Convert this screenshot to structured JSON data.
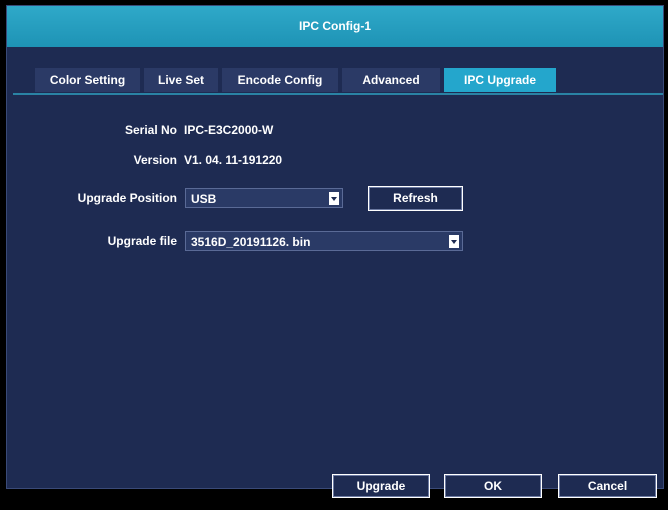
{
  "window": {
    "title": "IPC Config-1"
  },
  "tabs": [
    {
      "label": "Color Setting"
    },
    {
      "label": "Live Set"
    },
    {
      "label": "Encode Config"
    },
    {
      "label": "Advanced"
    },
    {
      "label": "IPC Upgrade",
      "active": true
    }
  ],
  "form": {
    "serial_label": "Serial No",
    "serial_value": "IPC-E3C2000-W",
    "version_label": "Version",
    "version_value": "V1. 04. 11-191220",
    "position_label": "Upgrade Position",
    "position_value": "USB",
    "refresh_label": "Refresh",
    "file_label": "Upgrade file",
    "file_value": "3516D_20191126. bin"
  },
  "footer": {
    "upgrade_label": "Upgrade",
    "ok_label": "OK",
    "cancel_label": "Cancel"
  },
  "colors": {
    "accent": "#24a6cc",
    "panel": "#1e2b52",
    "tab_bg": "#2b3a66"
  },
  "icons": {
    "dropdown": "chevron-down-icon"
  }
}
